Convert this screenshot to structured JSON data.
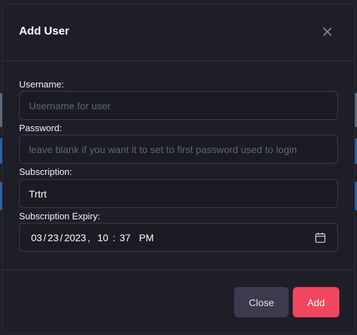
{
  "modal": {
    "title": "Add User",
    "close_icon": "close-icon"
  },
  "form": {
    "username": {
      "label": "Username:",
      "value": "",
      "placeholder": "Username for user"
    },
    "password": {
      "label": "Password:",
      "value": "",
      "placeholder": "leave blank if you want it to set to first password used to login"
    },
    "subscription": {
      "label": "Subscription:",
      "value": "Trtrt",
      "placeholder": ""
    },
    "expiry": {
      "label": "Subscription Expiry:",
      "month": "03",
      "day": "23",
      "year": "2023",
      "hour": "10",
      "minute": "37",
      "ampm": "PM",
      "date_sep": "/",
      "datetime_sep": ",",
      "time_sep": ":",
      "icon": "calendar-icon"
    }
  },
  "footer": {
    "close_label": "Close",
    "add_label": "Add"
  },
  "colors": {
    "accent": "#f0475e",
    "secondary_button": "#3b3b4d",
    "modal_bg": "#1e1e28"
  }
}
